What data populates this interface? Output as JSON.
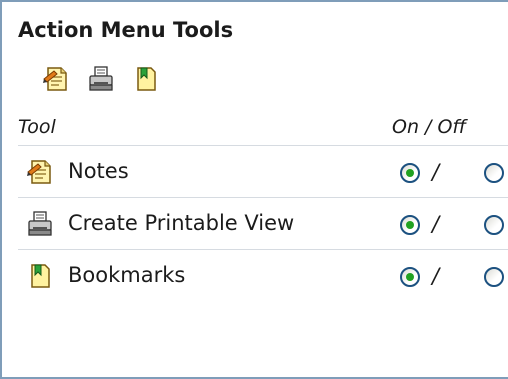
{
  "panel": {
    "title": "Action Menu Tools"
  },
  "toolbar": {
    "icons": [
      "notes-icon",
      "printer-icon",
      "bookmark-icon"
    ]
  },
  "table": {
    "headers": {
      "tool": "Tool",
      "on_off": "On / Off"
    },
    "separator": "/",
    "rows": [
      {
        "icon": "notes-icon",
        "label": "Notes",
        "on": true
      },
      {
        "icon": "printer-icon",
        "label": "Create Printable View",
        "on": true
      },
      {
        "icon": "bookmark-icon",
        "label": "Bookmarks",
        "on": true
      }
    ]
  },
  "colors": {
    "panel_border": "#7f9db9",
    "row_divider": "#d6dbe1",
    "radio_selected": "#21a121",
    "radio_border": "#1c5180"
  }
}
